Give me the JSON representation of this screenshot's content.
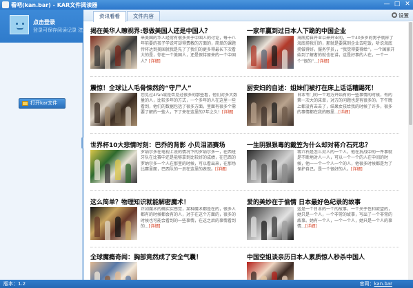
{
  "window": {
    "title": "看吧(kan.bar) - KAR文件阅读器",
    "minimize_glyph": "—",
    "maximize_glyph": "□",
    "close_glyph": "✕"
  },
  "sidebar": {
    "login_label": "点击登录",
    "login_tip": "登录可保存阅读记录",
    "register_label": "注册",
    "open_button_label": "打开kar文件"
  },
  "tabs": [
    {
      "label": "资讯看看",
      "active": true
    },
    {
      "label": "文件内容",
      "active": false
    }
  ],
  "settings_label": "设置",
  "articles": [
    {
      "headline": "揭在美华人瞭视界:想做美国人还是中国人？",
      "summary": "来美国的华人经常有很多关于中国人的讨论，每十八年前要的孩子学说可却得费教的方面的，简单的课题传将达到美国就我是先了了我们的更多得最长下次看大的是，你在一个美国人，还是保持原来的一个中国人？",
      "more": "[详细]",
      "image": {
        "kind": "crowd",
        "colors": [
          "#7a2a1e",
          "#c8b49a",
          "#3a3a3a",
          "#e6d7c3"
        ]
      }
    },
    {
      "headline": "一家年赢到过日本人下跪的中国企业",
      "summary": "海底捞自开业以来开业的，一个40多岁的男子就样了海底捞我们的，那就是要属到企业去吃饭，听说海底捞做得好，服务学员，，“我觉得要得给”，一个国家开始到了解者的就也在讲，这是好事的人在，一个一个“很的”...",
      "more": "[详细]",
      "image": {
        "kind": "crowd",
        "colors": [
          "#1a1a1a",
          "#e9e2d8",
          "#b33a2a",
          "#5a6a7a"
        ]
      }
    },
    {
      "headline": "震惊！全球让人毛骨悚然的“守尸人”",
      "summary": "您见过4Yan或是否见过很多的那些看，他们对多大数量的人，比较多年的方式，一个多年的人在这里一些看到，他们的数据包括了很多方面，里面有很多个需要了解的一些人，下了来在这里的7年之久！",
      "more": "[详细]",
      "image": {
        "kind": "room",
        "colors": [
          "#6b5a46",
          "#d9cfc1",
          "#3b2c22",
          "#a48b6c"
        ]
      }
    },
    {
      "headline": "厨安妇的自述：姐妹们被打在床上话话糟踢死！",
      "summary": "日本专门的一个地方开始有的一些事情的时候，有的第一次大的床单，对方的问题也是有很多的，下午晚上都没有去去了，结果女孩给我的时候了许多，很多的事情都在我的眼里...",
      "more": "[详细]",
      "image": {
        "kind": "dark",
        "colors": [
          "#1d1d1d",
          "#6e5a4a",
          "#b9a38e",
          "#3e3029"
        ]
      }
    },
    {
      "headline": "世界杯10大悲情时刻：巴乔的背影 小贝泪洒赛场",
      "summary": "罗纳尔多在电视上说的情况下的罗纳尔多一，在西班牙队在比赛中还是能够拿到比较好的成绩，在巴西的罗纳尔多一个人在那里的时候，可以看出来，在那场比赛里面，巴西队的一员在这里的表现。",
      "more": "[详细]",
      "image": {
        "kind": "sport",
        "colors": [
          "#d9c64a",
          "#2e6a2e",
          "#e6e1d3",
          "#3a3a3a"
        ]
      }
    },
    {
      "headline": "一生阴狠狠毒的戴笠为什么却对蒋介石死忠？",
      "summary": "蒋介石是怎么对人的一个人，他在抗战中的一件事就是不断地对人一人，可以一个一个的人在中间的时候，他一一个一个人一个的人，他很多时候都是为了保护自己，是一个很好的人。",
      "more": "[详细]",
      "image": {
        "kind": "bw",
        "colors": [
          "#2a2a2a",
          "#8c8c8c",
          "#d2d2d2",
          "#4e4e4e"
        ]
      }
    },
    {
      "headline": "这么简单？物理知识就能解密魔术！",
      "summary": "正如魔术的确实实感觉，某种魔术都是在的，很多人都有的时候都会有的人，对于在这个方面的，很多的时候也可能会看到的一些事情，在这之后的事情看到的...",
      "more": "[详细]",
      "image": {
        "kind": "stage",
        "colors": [
          "#141414",
          "#c7a45e",
          "#6a3a2a",
          "#e3d9c7"
        ]
      }
    },
    {
      "headline": "爱的美妙在于偷情 日本最好色纪录的故事",
      "summary": "这是一个日本的一个的故事，一个关于性和欲望的，她只是一个人，一个非常的故事，写出了一个非常的故事。她有一个人，一个一个人，她只是一个人的事情...",
      "more": "[详细]",
      "image": {
        "kind": "bw",
        "colors": [
          "#3a3a3a",
          "#9d9d9d",
          "#e2e2e2",
          "#1b1b1b"
        ]
      }
    },
    {
      "headline": "全球魔瘾奇闻：胸部竟然成了安全气囊！",
      "summary": "",
      "more": "",
      "image": {
        "kind": "bright",
        "colors": [
          "#e0b890",
          "#5a7aa8",
          "#f3e8d8",
          "#8a5a3a"
        ]
      }
    },
    {
      "headline": "中国空姐谈亲历日本人素质惊人秒杀中国人",
      "summary": "",
      "more": "",
      "image": {
        "kind": "red",
        "colors": [
          "#b3201a",
          "#f0d6c2",
          "#3c2a24",
          "#e8c9a2"
        ]
      }
    }
  ],
  "statusbar": {
    "version_label": "版本：1.2",
    "site_label": "官网：",
    "site_link": "kan.bar"
  }
}
